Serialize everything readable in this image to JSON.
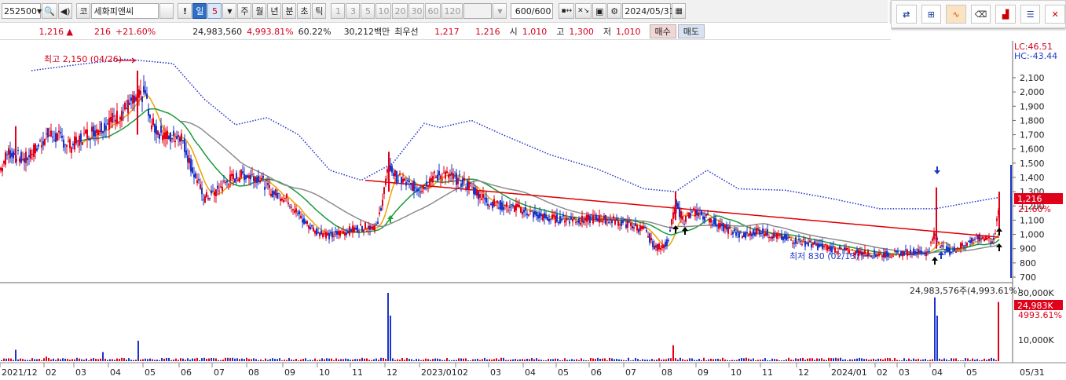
{
  "toolbar": {
    "code": "252500",
    "market_tag": "코",
    "stock_name": "세화피앤씨",
    "alert": "!",
    "period_day": "일",
    "period_value": "5",
    "period_week": "주",
    "period_month": "월",
    "period_year": "년",
    "period_minute": "분",
    "period_second": "초",
    "period_tick": "틱",
    "intervals": [
      "1",
      "3",
      "5",
      "10",
      "20",
      "30",
      "60",
      "120"
    ],
    "count": "600/600",
    "date": "2024/05/31"
  },
  "quote": {
    "price": "1,216 ▲",
    "change": "216",
    "change_pct": "+21.60%",
    "volume": "24,983,560",
    "volume_pct": "4,993.81%",
    "turnover": "60.22%",
    "amount": "30,212백만",
    "priority_label": "최우선",
    "ask": "1,217",
    "bid": "1,216",
    "open_label": "시",
    "open": "1,010",
    "high_label": "고",
    "high": "1,300",
    "low_label": "저",
    "low": "1,010",
    "buy_label": "매수",
    "sell_label": "매도"
  },
  "chart": {
    "lc_label": "LC:46.51",
    "hc_label": "HC:-43.44",
    "high_annotation": "최고 2,150 (04/26)",
    "low_annotation": "최저 830 (02/13)",
    "price_ticks": [
      "2,100",
      "2,000",
      "1,900",
      "1,800",
      "1,700",
      "1,600",
      "1,500",
      "1,400",
      "1,300",
      "1,200",
      "1,100",
      "1,000",
      "900",
      "800",
      "700"
    ],
    "current_price": "1,216",
    "current_pct": "21.60%",
    "volume_annotation": "24,983,576주(4,993.61%)",
    "volume_ticks": [
      "30,000K",
      "10,000K"
    ],
    "current_volume": "24,983K",
    "current_volume_pct": "4993.61%",
    "x_labels": [
      "2021/12",
      "02",
      "03",
      "04",
      "05",
      "06",
      "07",
      "08",
      "09",
      "10",
      "11",
      "12",
      "2023/01",
      "02",
      "03",
      "04",
      "05",
      "06",
      "07",
      "08",
      "09",
      "10",
      "11",
      "12",
      "2024/01",
      "02",
      "03",
      "04",
      "05"
    ],
    "x_end_label": "05/31",
    "colors": {
      "up": "#e0001a",
      "down": "#1a35c8",
      "ma1": "#f0a000",
      "ma2": "#1a9a3a",
      "ma3": "#8c8c8c",
      "ma4": "#e00000",
      "envelope": "#1f2fc8"
    }
  }
}
